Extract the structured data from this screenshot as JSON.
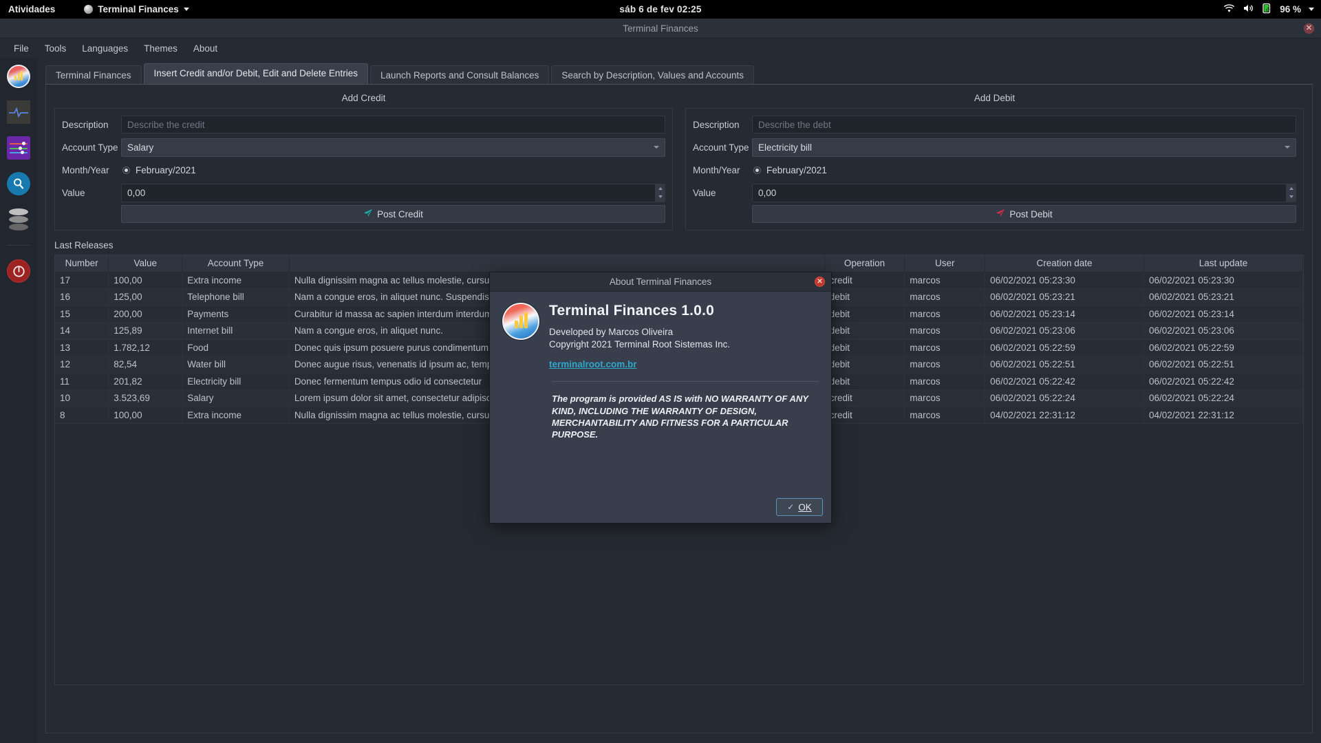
{
  "topbar": {
    "activities": "Atividades",
    "app_menu": "Terminal Finances",
    "clock": "sáb 6 de fev  02:25",
    "battery": "96 %"
  },
  "window": {
    "title": "Terminal Finances",
    "close_label": "✕"
  },
  "menubar": {
    "items": [
      "File",
      "Tools",
      "Languages",
      "Themes",
      "About"
    ]
  },
  "sidebar": {
    "items": [
      {
        "name": "app-logo",
        "label": "Terminal Finances"
      },
      {
        "name": "pulse",
        "label": "Monitor"
      },
      {
        "name": "sliders",
        "label": "Settings"
      },
      {
        "name": "search",
        "label": "Search"
      },
      {
        "name": "database",
        "label": "Database"
      },
      {
        "name": "power",
        "label": "Exit"
      }
    ]
  },
  "tabs": [
    {
      "label": "Terminal Finances",
      "active": false
    },
    {
      "label": "Insert Credit and/or Debit, Edit and Delete Entries",
      "active": true
    },
    {
      "label": "Launch Reports and Consult Balances",
      "active": false
    },
    {
      "label": "Search by Description, Values and Accounts",
      "active": false
    }
  ],
  "credit_form": {
    "title": "Add Credit",
    "description_label": "Description",
    "description_placeholder": "Describe the credit",
    "description_value": "",
    "account_type_label": "Account Type",
    "account_type_value": "Salary",
    "month_year_label": "Month/Year",
    "month_year_value": "February/2021",
    "value_label": "Value",
    "value_value": "0,00",
    "post_label": "Post Credit",
    "post_icon_color": "#19b6a8"
  },
  "debit_form": {
    "title": "Add Debit",
    "description_label": "Description",
    "description_placeholder": "Describe the debt",
    "description_value": "",
    "account_type_label": "Account Type",
    "account_type_value": "Electricity bill",
    "month_year_label": "Month/Year",
    "month_year_value": "February/2021",
    "value_label": "Value",
    "value_value": "0,00",
    "post_label": "Post Debit",
    "post_icon_color": "#e02b4b"
  },
  "table": {
    "caption": "Last Releases",
    "columns": [
      "Number",
      "Value",
      "Account Type",
      "",
      "Operation",
      "User",
      "Creation date",
      "Last update"
    ],
    "rows": [
      {
        "number": "17",
        "value": "100,00",
        "account": "Extra income",
        "description": "Nulla dignissim magna ac tellus molestie, cursus",
        "operation": "credit",
        "user": "marcos",
        "created": "06/02/2021 05:23:30",
        "updated": "06/02/2021 05:23:30"
      },
      {
        "number": "16",
        "value": "125,00",
        "account": "Telephone bill",
        "description": "Nam a congue eros, in aliquet nunc. Suspendisse",
        "operation": "debit",
        "user": "marcos",
        "created": "06/02/2021 05:23:21",
        "updated": "06/02/2021 05:23:21"
      },
      {
        "number": "15",
        "value": "200,00",
        "account": "Payments",
        "description": "Curabitur id massa ac sapien interdum interdum",
        "operation": "debit",
        "user": "marcos",
        "created": "06/02/2021 05:23:14",
        "updated": "06/02/2021 05:23:14"
      },
      {
        "number": "14",
        "value": "125,89",
        "account": "Internet bill",
        "description": "Nam a congue eros, in aliquet nunc.",
        "operation": "debit",
        "user": "marcos",
        "created": "06/02/2021 05:23:06",
        "updated": "06/02/2021 05:23:06"
      },
      {
        "number": "13",
        "value": "1.782,12",
        "account": "Food",
        "description": "Donec quis ipsum posuere purus condimentum",
        "operation": "debit",
        "user": "marcos",
        "created": "06/02/2021 05:22:59",
        "updated": "06/02/2021 05:22:59"
      },
      {
        "number": "12",
        "value": "82,54",
        "account": "Water bill",
        "description": "Donec augue risus, venenatis id ipsum ac, tempus",
        "operation": "debit",
        "user": "marcos",
        "created": "06/02/2021 05:22:51",
        "updated": "06/02/2021 05:22:51"
      },
      {
        "number": "11",
        "value": "201,82",
        "account": "Electricity bill",
        "description": "Donec fermentum tempus odio id consectetur",
        "operation": "debit",
        "user": "marcos",
        "created": "06/02/2021 05:22:42",
        "updated": "06/02/2021 05:22:42"
      },
      {
        "number": "10",
        "value": "3.523,69",
        "account": "Salary",
        "description": "Lorem ipsum dolor sit amet, consectetur adipiscing",
        "operation": "credit",
        "user": "marcos",
        "created": "06/02/2021 05:22:24",
        "updated": "06/02/2021 05:22:24"
      },
      {
        "number": "8",
        "value": "100,00",
        "account": "Extra income",
        "description": "Nulla dignissim magna ac tellus molestie, cursus",
        "operation": "credit",
        "user": "marcos",
        "created": "04/02/2021 22:31:12",
        "updated": "04/02/2021 22:31:12"
      }
    ]
  },
  "dialog": {
    "title": "About Terminal Finances",
    "close_label": "✕",
    "heading": "Terminal Finances 1.0.0",
    "developed_by": "Developed by Marcos Oliveira",
    "copyright": "Copyright 2021 Terminal Root Sistemas Inc.",
    "link": "terminalroot.com.br",
    "warranty": "The program is provided AS IS with NO WARRANTY OF ANY KIND, INCLUDING THE WARRANTY OF DESIGN, MERCHANTABILITY AND FITNESS FOR A PARTICULAR PURPOSE.",
    "ok_label": "OK",
    "link_color": "#2fa8cc"
  }
}
